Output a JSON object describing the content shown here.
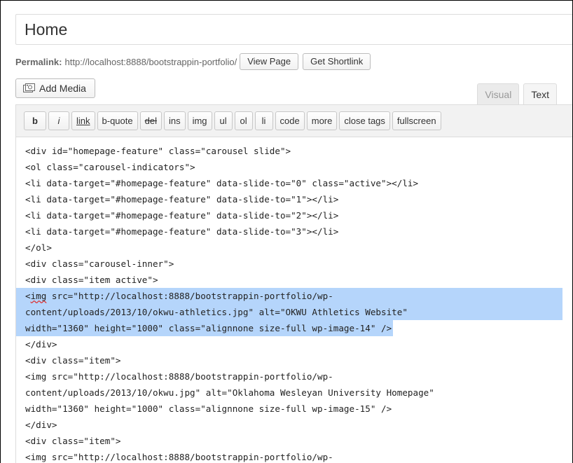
{
  "post": {
    "title": "Home"
  },
  "permalink": {
    "label": "Permalink:",
    "url": "http://localhost:8888/bootstrappin-portfolio/",
    "view_button": "View Page",
    "shortlink_button": "Get Shortlink"
  },
  "media": {
    "add_label": "Add Media",
    "icon": "media-camera-icon"
  },
  "tabs": [
    {
      "label": "Visual",
      "active": false
    },
    {
      "label": "Text",
      "active": true
    }
  ],
  "quicktags": [
    "b",
    "i",
    "link",
    "b-quote",
    "del",
    "ins",
    "img",
    "ul",
    "ol",
    "li",
    "code",
    "more",
    "close tags",
    "fullscreen"
  ],
  "code_lines": [
    "<div id=\"homepage-feature\" class=\"carousel slide\">",
    "<ol class=\"carousel-indicators\">",
    "<li data-target=\"#homepage-feature\" data-slide-to=\"0\" class=\"active\"></li>",
    "<li data-target=\"#homepage-feature\" data-slide-to=\"1\"></li>",
    "<li data-target=\"#homepage-feature\" data-slide-to=\"2\"></li>",
    "<li data-target=\"#homepage-feature\" data-slide-to=\"3\"></li>",
    "</ol>",
    "<div class=\"carousel-inner\">",
    "<div class=\"item active\">",
    "<img src=\"http://localhost:8888/bootstrappin-portfolio/wp-",
    "content/uploads/2013/10/okwu-athletics.jpg\" alt=\"OKWU Athletics Website\"",
    "width=\"1360\" height=\"1000\" class=\"alignnone size-full wp-image-14\" />",
    "</div>",
    "<div class=\"item\">",
    "<img src=\"http://localhost:8888/bootstrappin-portfolio/wp-",
    "content/uploads/2013/10/okwu.jpg\" alt=\"Oklahoma Wesleyan University Homepage\"",
    "width=\"1360\" height=\"1000\" class=\"alignnone size-full wp-image-15\" />",
    "</div>",
    "<div class=\"item\">",
    "<img src=\"http://localhost:8888/bootstrappin-portfolio/wp-"
  ],
  "selected_lines": [
    9,
    10,
    11
  ],
  "colors": {
    "selection": "#b5d5fb",
    "spellcheck": "#d33"
  }
}
